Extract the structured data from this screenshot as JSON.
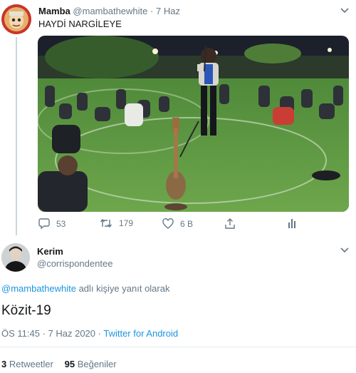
{
  "parent_tweet": {
    "display_name": "Mamba",
    "handle": "@mambathewhite",
    "separator": "·",
    "time": "7 Haz",
    "text": "HAYDİ NARGİLEYE",
    "stats": {
      "replies": "53",
      "retweets": "179",
      "likes": "6 B"
    }
  },
  "reply_tweet": {
    "display_name": "Kerim",
    "handle": "@corrispondentee",
    "reply_to_handle": "@mambathewhite",
    "reply_to_suffix": " adlı kişiye yanıt olarak",
    "text": "Közit-19",
    "time": "ÖS 11:45 · 7 Haz 2020",
    "dot": " · ",
    "source": "Twitter for Android",
    "retweet_count": "3",
    "retweet_label": " Retweetler",
    "like_count": "95",
    "like_label": " Beğeniler"
  },
  "colors": {
    "link": "#1b95e0",
    "muted": "#657786",
    "text": "#14171a",
    "divider": "#e6ecf0"
  }
}
